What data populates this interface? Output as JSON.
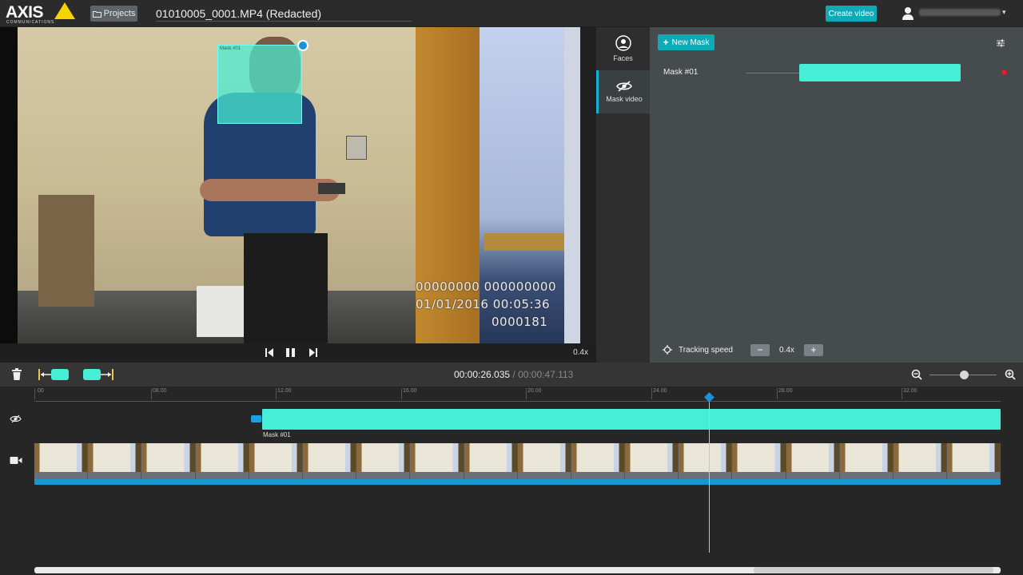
{
  "app": {
    "brand": "AXIS",
    "brand_sub": "COMMUNICATIONS",
    "projects_label": "Projects",
    "file_title": "01010005_0001.MP4 (Redacted)",
    "create_video_label": "Create video"
  },
  "video": {
    "mask_box_label": "Mask #01",
    "overlay_line1": "00000000 000000000",
    "overlay_line2": "01/01/2016 00:05:36",
    "overlay_line3": "0000181",
    "playback_speed": "0.4x"
  },
  "side_tabs": {
    "faces": "Faces",
    "mask_video": "Mask video"
  },
  "mask_panel": {
    "new_mask_label": "New Mask",
    "mask_name": "Mask #01",
    "tracking_speed_label": "Tracking speed",
    "tracking_speed_value": "0.4x"
  },
  "timeline": {
    "current_time": "00:00:26.035",
    "separator": " / ",
    "total_time": "00:00:47.113",
    "ticks": [
      ".00",
      "08.00",
      "12.00",
      "16.00",
      "20.00",
      "24.00",
      "28.00",
      "32.00"
    ],
    "mask_track_label": "Mask #01"
  },
  "colors": {
    "accent": "#10a9b8",
    "mask": "#46eed6",
    "playhead": "#f0c54a",
    "track_bar": "#1a97d2"
  }
}
